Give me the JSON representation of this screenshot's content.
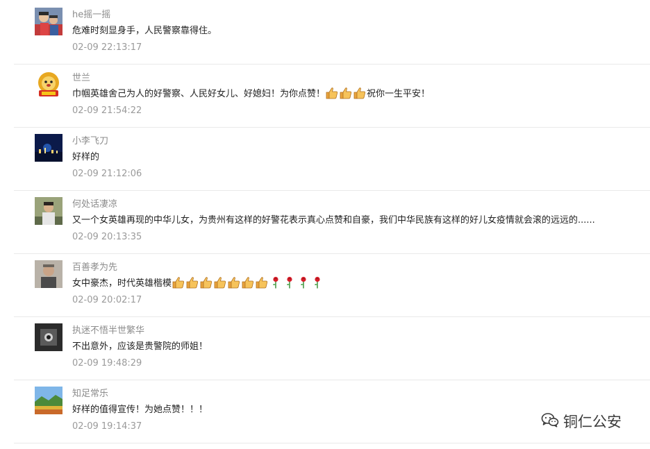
{
  "colors": {
    "name": "#8c8c8c",
    "text": "#222222",
    "time": "#9a9a9a",
    "separator": "#e9e9e9"
  },
  "watermark": {
    "icon": "wechat-icon",
    "text": "铜仁公安"
  },
  "comments": [
    {
      "name": "he摇一摇",
      "text_before": "危难时刻显身手，人民警察靠得住。",
      "text_after": "",
      "emoji": [],
      "time": "02-09 22:13:17",
      "avatar": "family-photo"
    },
    {
      "name": "世兰",
      "text_before": "巾帼英雄舍己为人的好警察、人民好女儿、好媳妇！为你点赞！",
      "text_after": "祝你一生平安！",
      "emoji": [
        "thumbs-up",
        "thumbs-up",
        "thumbs-up"
      ],
      "time": "02-09 21:54:22",
      "avatar": "lion-mascot"
    },
    {
      "name": "小李飞刀",
      "text_before": "好样的",
      "text_after": "",
      "emoji": [],
      "time": "02-09 21:12:06",
      "avatar": "night-city"
    },
    {
      "name": "何处话凄凉",
      "text_before": "又一个女英雄再现的中华儿女，为贵州有这样的好警花表示真心点赞和自豪，我们中华民族有这样的好儿女疫情就会滚的远远的......",
      "text_after": "",
      "emoji": [],
      "time": "02-09 20:13:35",
      "avatar": "person-portrait"
    },
    {
      "name": "百善孝为先",
      "text_before": "女中豪杰，时代英雄楷模",
      "text_after": "",
      "emoji": [
        "thumbs-up",
        "thumbs-up",
        "thumbs-up",
        "thumbs-up",
        "thumbs-up",
        "thumbs-up",
        "thumbs-up",
        "rose",
        "rose",
        "rose",
        "rose"
      ],
      "time": "02-09 20:02:17",
      "avatar": "older-man"
    },
    {
      "name": "执迷不悟半世繁华",
      "text_before": "不出意外，应该是贵警院的师姐！",
      "text_after": "",
      "emoji": [],
      "time": "02-09 19:48:29",
      "avatar": "dark-scene"
    },
    {
      "name": "知足常乐",
      "text_before": "好样的值得宣传！为她点赞！！！",
      "text_after": "",
      "emoji": [],
      "time": "02-09 19:14:37",
      "avatar": "landscape"
    }
  ]
}
